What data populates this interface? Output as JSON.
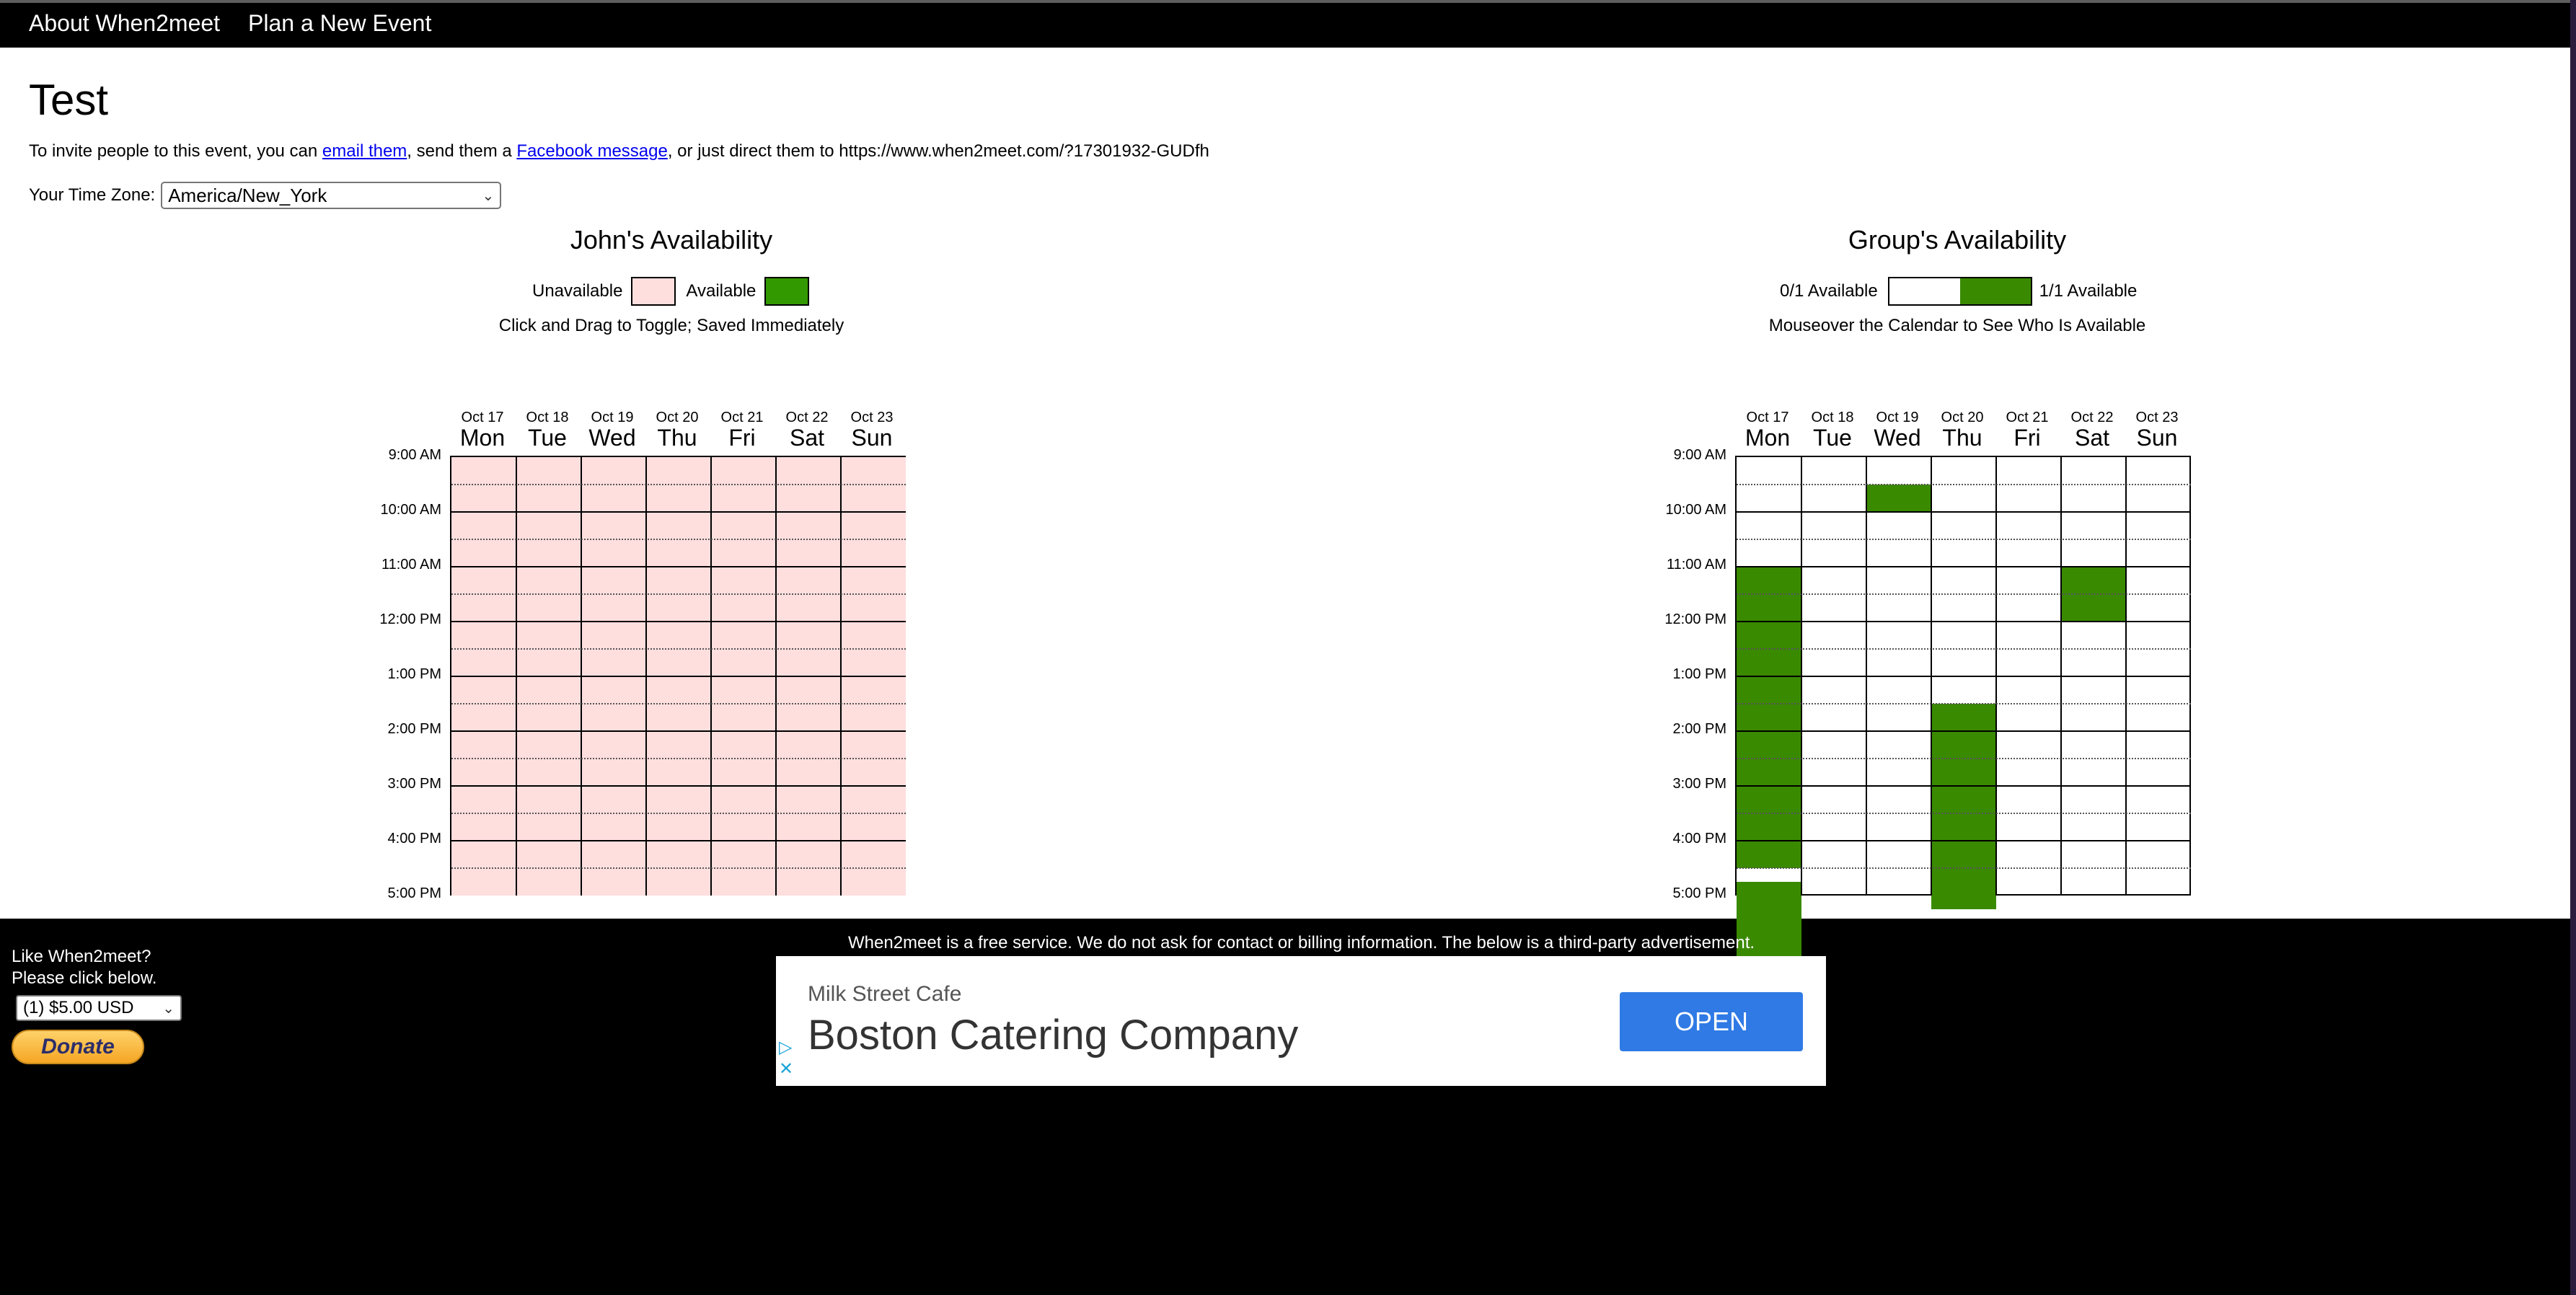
{
  "nav": {
    "about": "About When2meet",
    "plan": "Plan a New Event"
  },
  "event": {
    "title": "Test",
    "invite_prefix": "To invite people to this event, you can ",
    "email_link": "email them",
    "invite_middle": ", send them a ",
    "facebook_link": "Facebook message",
    "invite_suffix": ", or just direct them to https://www.when2meet.com/?17301932-GUDfh"
  },
  "timezone": {
    "label": "Your Time Zone:",
    "value": "America/New_York"
  },
  "days": [
    {
      "date": "Oct 17",
      "weekday": "Mon"
    },
    {
      "date": "Oct 18",
      "weekday": "Tue"
    },
    {
      "date": "Oct 19",
      "weekday": "Wed"
    },
    {
      "date": "Oct 20",
      "weekday": "Thu"
    },
    {
      "date": "Oct 21",
      "weekday": "Fri"
    },
    {
      "date": "Oct 22",
      "weekday": "Sat"
    },
    {
      "date": "Oct 23",
      "weekday": "Sun"
    }
  ],
  "times": [
    "9:00 AM",
    "10:00 AM",
    "11:00 AM",
    "12:00 PM",
    "1:00 PM",
    "2:00 PM",
    "3:00 PM",
    "4:00 PM",
    "5:00 PM"
  ],
  "personal": {
    "title": "John's Availability",
    "unavailable_label": "Unavailable",
    "available_label": "Available",
    "hint": "Click and Drag to Toggle; Saved Immediately",
    "unavailable_color": "#ffdede",
    "available_color": "#339900"
  },
  "group": {
    "title": "Group's Availability",
    "min_label": "0/1 Available",
    "max_label": "1/1 Available",
    "hint": "Mouseover the Calendar to See Who Is Available",
    "available_color": "#3a8a00",
    "available_slots": {
      "Mon": [
        [
          2,
          7.5
        ],
        [
          7.75,
          10
        ]
      ],
      "Wed": [
        [
          0.5,
          1
        ]
      ],
      "Thu": [
        [
          4.5,
          8.25
        ]
      ],
      "Sat": [
        [
          2,
          3
        ]
      ]
    }
  },
  "footer": {
    "like_line1": "Like When2meet?",
    "like_line2": "Please click below.",
    "amount": "(1) $5.00 USD",
    "donate": "Donate",
    "notice": "When2meet is a free service. We do not ask for contact or billing information. The below is a third-party advertisement."
  },
  "ad": {
    "subtitle": "Milk Street Cafe",
    "headline": "Boston Catering Company",
    "button": "OPEN",
    "button_color": "#2f7ae5"
  }
}
